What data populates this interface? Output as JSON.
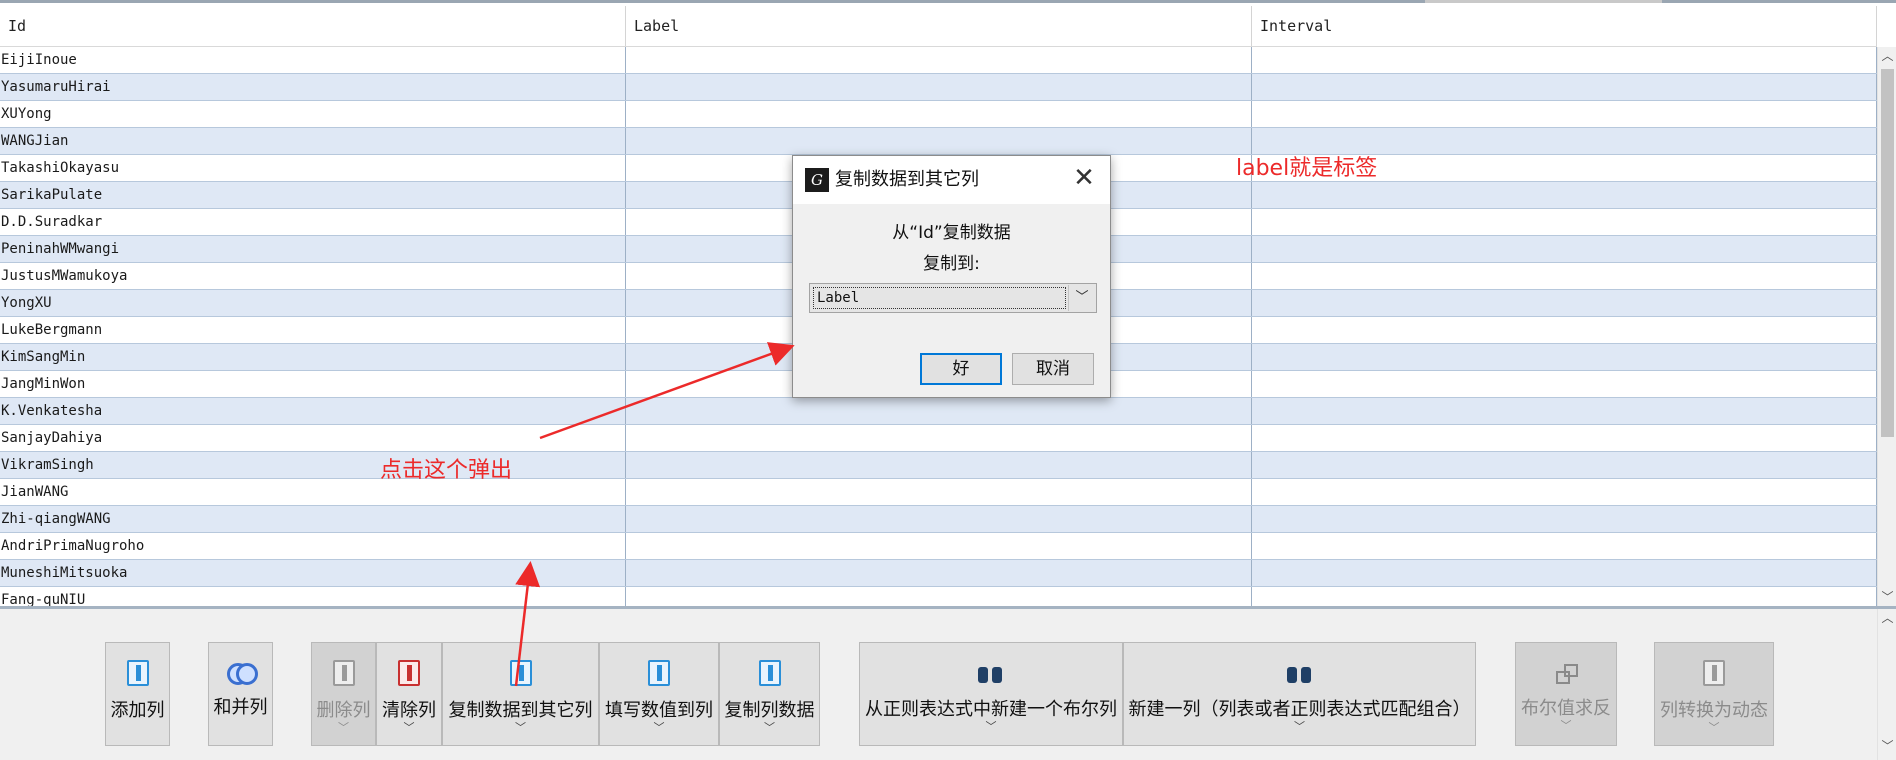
{
  "table": {
    "columns": [
      "Id",
      "Label",
      "Interval"
    ],
    "rows": [
      {
        "id": "EijiInoue",
        "label": "",
        "interval": ""
      },
      {
        "id": "YasumaruHirai",
        "label": "",
        "interval": ""
      },
      {
        "id": "XUYong",
        "label": "",
        "interval": ""
      },
      {
        "id": "WANGJian",
        "label": "",
        "interval": ""
      },
      {
        "id": "TakashiOkayasu",
        "label": "",
        "interval": ""
      },
      {
        "id": "SarikaPulate",
        "label": "",
        "interval": ""
      },
      {
        "id": "D.D.Suradkar",
        "label": "",
        "interval": ""
      },
      {
        "id": "PeninahWMwangi",
        "label": "",
        "interval": ""
      },
      {
        "id": "JustusMWamukoya",
        "label": "",
        "interval": ""
      },
      {
        "id": "YongXU",
        "label": "",
        "interval": ""
      },
      {
        "id": "LukeBergmann",
        "label": "",
        "interval": ""
      },
      {
        "id": "KimSangMin",
        "label": "",
        "interval": ""
      },
      {
        "id": "JangMinWon",
        "label": "",
        "interval": ""
      },
      {
        "id": "K.Venkatesha",
        "label": "",
        "interval": ""
      },
      {
        "id": "SanjayDahiya",
        "label": "",
        "interval": ""
      },
      {
        "id": "VikramSingh",
        "label": "",
        "interval": ""
      },
      {
        "id": "JianWANG",
        "label": "",
        "interval": ""
      },
      {
        "id": "Zhi-qiangWANG",
        "label": "",
        "interval": ""
      },
      {
        "id": "AndriPrimaNugroho",
        "label": "",
        "interval": ""
      },
      {
        "id": "MuneshiMitsuoka",
        "label": "",
        "interval": ""
      },
      {
        "id": "Fang-quNIU",
        "label": "",
        "interval": ""
      }
    ]
  },
  "toolbar": {
    "buttons": [
      {
        "label": "添加列",
        "icon": "add-column-icon",
        "dropdown": false,
        "enabled": true
      },
      {
        "label": "和并列",
        "icon": "merge-columns-icon",
        "dropdown": false,
        "enabled": true
      },
      {
        "label": "删除列",
        "icon": "delete-column-icon",
        "dropdown": true,
        "enabled": false
      },
      {
        "label": "清除列",
        "icon": "clear-column-icon",
        "dropdown": true,
        "enabled": true
      },
      {
        "label": "复制数据到其它列",
        "icon": "copy-data-icon",
        "dropdown": true,
        "enabled": true
      },
      {
        "label": "填写数值到列",
        "icon": "fill-values-icon",
        "dropdown": true,
        "enabled": true
      },
      {
        "label": "复制列数据",
        "icon": "duplicate-column-icon",
        "dropdown": true,
        "enabled": true
      },
      {
        "label": "从正则表达式中新建一个布尔列",
        "icon": "binoculars-icon",
        "dropdown": true,
        "enabled": true
      },
      {
        "label": "新建一列（列表或者正则表达式匹配组合）",
        "icon": "binoculars-icon",
        "dropdown": true,
        "enabled": true
      },
      {
        "label": "布尔值求反",
        "icon": "boolean-negate-icon",
        "dropdown": true,
        "enabled": false
      },
      {
        "label": "列转换为动态",
        "icon": "convert-dynamic-icon",
        "dropdown": true,
        "enabled": false
      }
    ]
  },
  "dialog": {
    "title": "复制数据到其它列",
    "logo_text": "G",
    "message_from": "从“Id”复制数据",
    "message_to": "复制到:",
    "selected_option": "Label",
    "ok_label": "好",
    "cancel_label": "取消"
  },
  "annotations": {
    "label_note": "label就是标签",
    "click_note": "点击这个弹出"
  },
  "colors": {
    "row_alt": "#dfe8f5",
    "annotation": "#ec2a2a",
    "ok_border": "#0078d7"
  }
}
